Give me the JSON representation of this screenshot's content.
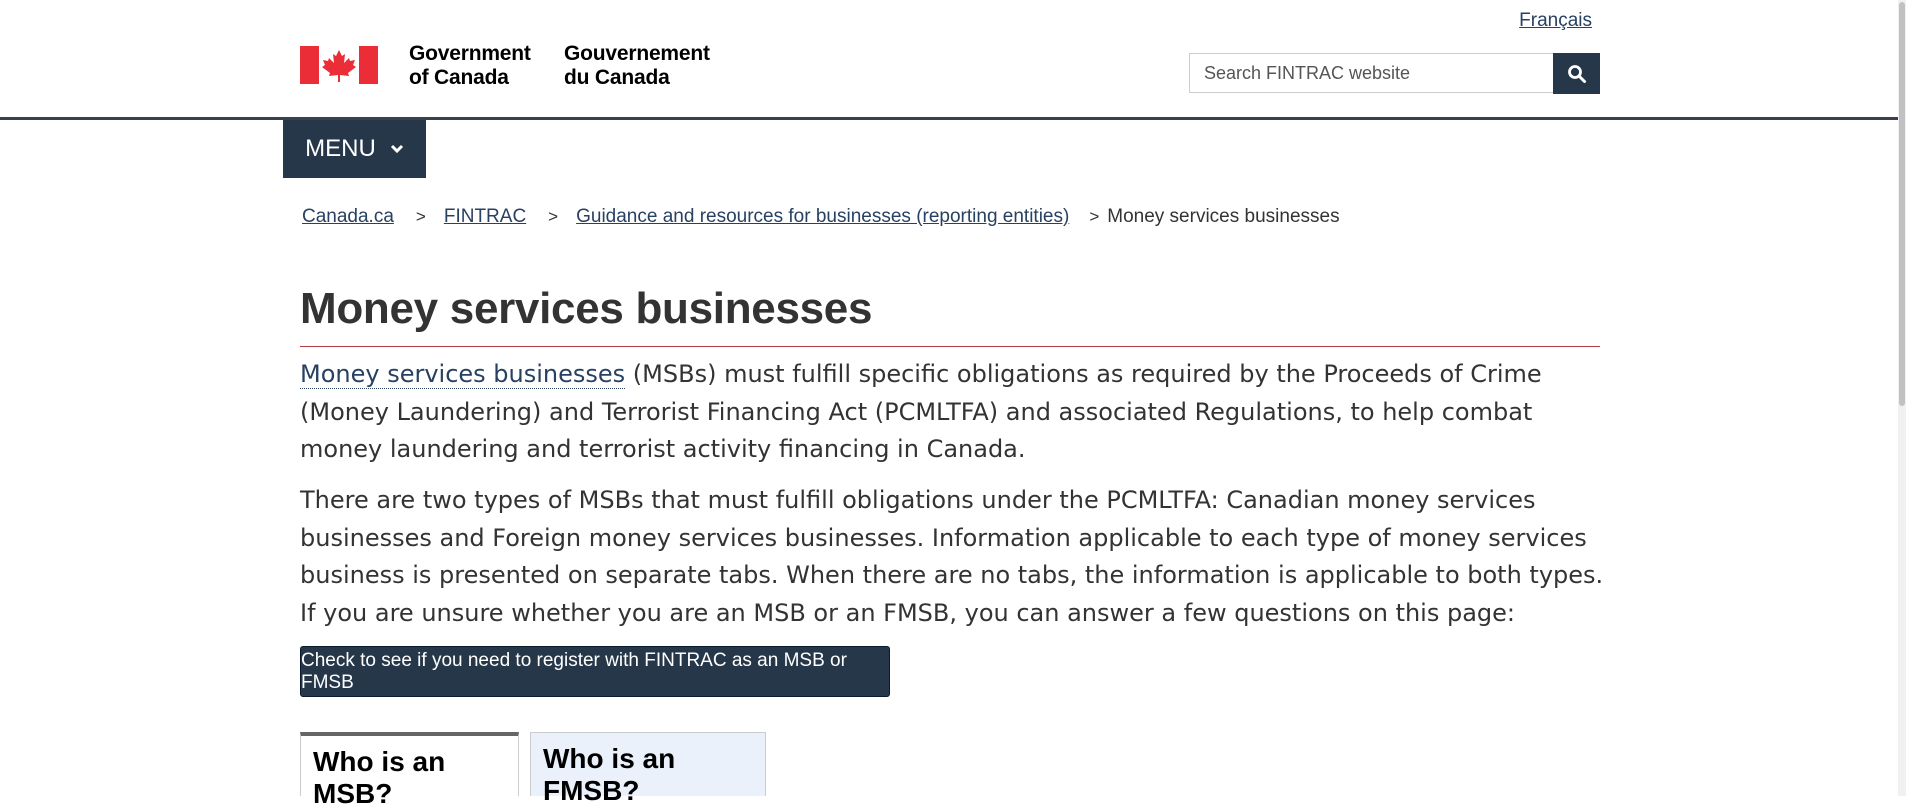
{
  "header": {
    "language_link": "Français",
    "signature_en": [
      "Government",
      "of Canada"
    ],
    "signature_fr": [
      "Gouvernement",
      "du Canada"
    ],
    "search_placeholder": "Search FINTRAC website",
    "search_icon": "search-icon"
  },
  "menu": {
    "label": "MENU",
    "icon": "chevron-down-icon"
  },
  "breadcrumb": [
    {
      "label": "Canada.ca",
      "link": true
    },
    {
      "label": "FINTRAC",
      "link": true
    },
    {
      "label": "Guidance and resources for businesses (reporting entities)",
      "link": true
    },
    {
      "label": "Money services businesses",
      "link": false
    }
  ],
  "main": {
    "title": "Money services businesses",
    "para1_link": "Money services businesses",
    "para1_rest": " (MSBs) must fulfill specific obligations as required by the Proceeds of Crime (Money Laundering) and Terrorist Financing Act (PCMLTFA) and associated Regulations, to help combat money laundering and terrorist activity financing in Canada.",
    "para2": "There are two types of MSBs that must fulfill obligations under the PCMLTFA: Canadian money services businesses and Foreign money services businesses. Information applicable to each type of money services business is presented on separate tabs. When there are no tabs, the information is applicable to both types. If you are unsure whether you are an MSB or an FMSB, you can answer a few questions on this page:",
    "cta_label": "Check to see if you need to register with FINTRAC as an MSB or FMSB",
    "tabs": [
      {
        "label": "Who is an MSB?",
        "active": true
      },
      {
        "label": "Who is an FMSB?",
        "active": false
      }
    ]
  },
  "colors": {
    "navy": "#26374a",
    "link": "#284162",
    "title_rule": "#af3c43",
    "flag_red": "#eb2d37"
  }
}
